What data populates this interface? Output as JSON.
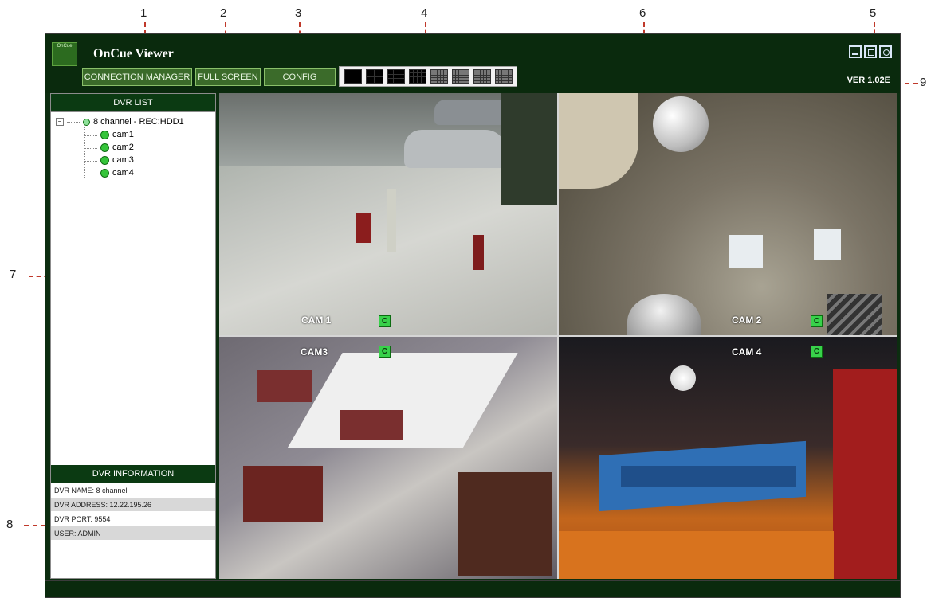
{
  "callouts": [
    "1",
    "2",
    "3",
    "4",
    "5",
    "6",
    "7",
    "8",
    "9"
  ],
  "app": {
    "title": "OnCue Viewer",
    "version": "VER 1.02E",
    "logo_text": "OnCue"
  },
  "toolbar": {
    "connection_manager": "CONNECTION MANAGER",
    "full_screen": "FULL SCREEN",
    "config": "CONFIG"
  },
  "layouts": [
    "1",
    "4",
    "9",
    "16",
    "25",
    "36",
    "49",
    "64"
  ],
  "sidebar": {
    "dvr_list_title": "DVR LIST",
    "root_label": "8 channel - REC:HDD1",
    "cameras": [
      "cam1",
      "cam2",
      "cam3",
      "cam4"
    ],
    "dvr_info_title": "DVR INFORMATION",
    "info": {
      "name": "DVR NAME: 8 channel",
      "address": "DVR ADDRESS: 12.22.195.26",
      "port": "DVR PORT: 9554",
      "user": "USER: ADMIN"
    }
  },
  "feeds": [
    {
      "label": "CAM 1",
      "badge": "C"
    },
    {
      "label": "CAM 2",
      "badge": "C"
    },
    {
      "label": "CAM3",
      "badge": "C"
    },
    {
      "label": "CAM 4",
      "badge": "C"
    }
  ],
  "colors": {
    "frame": "#0a2a0d",
    "accent": "#38d14a",
    "button": "#3b6b2a",
    "callout_line": "#c0392b"
  }
}
